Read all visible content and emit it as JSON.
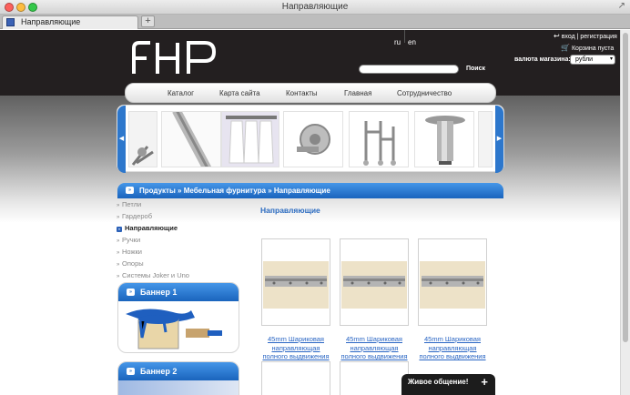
{
  "window": {
    "title": "Направляющие"
  },
  "tab": {
    "label": "Направляющие",
    "new_tab": "+"
  },
  "header": {
    "logo": "FHP",
    "lang_ru": "ru",
    "lang_en": "en",
    "login": "вход | регистрация",
    "cart": "Корзина пуста",
    "search_placeholder": "",
    "search_button": "Поиск",
    "currency_label": "валюта магазина:",
    "currency_value": "рубли"
  },
  "nav": {
    "items": [
      "Каталог",
      "Карта сайта",
      "Контакты",
      "Главная",
      "Сотрудничество"
    ]
  },
  "breadcrumb": {
    "items": [
      "Продукты",
      "Мебельная фурнитура",
      "Направляющие"
    ],
    "separator": "»"
  },
  "categories": [
    {
      "label": "Петли",
      "active": false
    },
    {
      "label": "Гардероб",
      "active": false
    },
    {
      "label": "Направляющие",
      "active": true
    },
    {
      "label": "Ручки",
      "active": false
    },
    {
      "label": "Ножки",
      "active": false
    },
    {
      "label": "Опоры",
      "active": false
    },
    {
      "label": "Системы Joker и Uno",
      "active": false
    }
  ],
  "banners": [
    {
      "title": "Баннер 1"
    },
    {
      "title": "Баннер 2"
    }
  ],
  "main": {
    "heading": "Направляющие"
  },
  "products": [
    {
      "name": "45mm Шариковая направляющая полного выдвижения"
    },
    {
      "name": "45mm Шариковая направляющая полного выдвижения"
    },
    {
      "name": "45mm Шариковая направляющая полного выдвижения"
    }
  ],
  "chat": {
    "label": "Живое общение!",
    "plus": "+"
  }
}
